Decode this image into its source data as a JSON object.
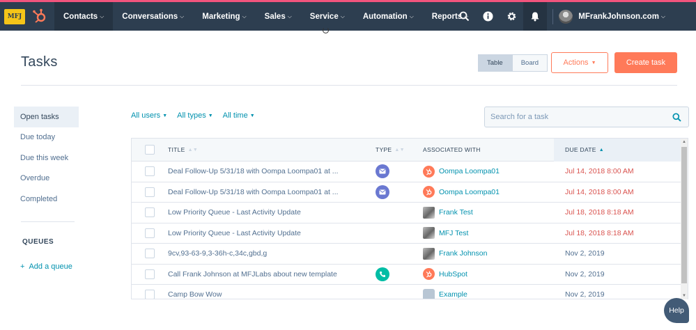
{
  "nav": {
    "logo_text": "MFJ",
    "items": [
      {
        "label": "Contacts",
        "active": true
      },
      {
        "label": "Conversations"
      },
      {
        "label": "Marketing"
      },
      {
        "label": "Sales"
      },
      {
        "label": "Service"
      },
      {
        "label": "Automation"
      },
      {
        "label": "Reports"
      }
    ],
    "account": "MFrankJohnson.com",
    "icons": [
      "search-icon",
      "info-icon",
      "gear-icon",
      "bell-icon"
    ]
  },
  "header": {
    "title": "Tasks",
    "view_table": "Table",
    "view_board": "Board",
    "actions_label": "Actions",
    "create_label": "Create task"
  },
  "sidebar": {
    "items": [
      "Open tasks",
      "Due today",
      "Due this week",
      "Overdue",
      "Completed"
    ],
    "queues_heading": "QUEUES",
    "add_queue": "Add a queue"
  },
  "filters": {
    "users": "All users",
    "types": "All types",
    "time": "All time",
    "search_placeholder": "Search for a task"
  },
  "table": {
    "columns": {
      "title": "TITLE",
      "type": "TYPE",
      "associated": "ASSOCIATED WITH",
      "due": "DUE DATE"
    },
    "rows": [
      {
        "title": "Deal Follow-Up 5/31/18 with Oompa Loompa01 at ...",
        "type": "email-icon",
        "assoc": "Oompa Loompa01",
        "assoc_icon": "hubspot-icon",
        "due": "Jul 14, 2018 8:00 AM",
        "overdue": true
      },
      {
        "title": "Deal Follow-Up 5/31/18 with Oompa Loompa01 at ...",
        "type": "email-icon",
        "assoc": "Oompa Loompa01",
        "assoc_icon": "hubspot-icon",
        "due": "Jul 14, 2018 8:00 AM",
        "overdue": true
      },
      {
        "title": "Low Priority Queue - Last Activity Update",
        "type": "",
        "assoc": "Frank Test",
        "assoc_icon": "contact-photo-icon",
        "due": "Jul 18, 2018 8:18 AM",
        "overdue": true
      },
      {
        "title": "Low Priority Queue - Last Activity Update",
        "type": "",
        "assoc": "MFJ Test",
        "assoc_icon": "contact-photo-icon",
        "due": "Jul 18, 2018 8:18 AM",
        "overdue": true
      },
      {
        "title": "9cv,93-63-9,3-36h-c,34c,gbd,g",
        "type": "",
        "assoc": "Frank Johnson",
        "assoc_icon": "contact-photo-icon",
        "due": "Nov 2, 2019",
        "overdue": false
      },
      {
        "title": "Call Frank Johnson at MFJLabs about new template",
        "type": "call-icon",
        "assoc": "HubSpot",
        "assoc_icon": "hubspot-icon",
        "due": "Nov 2, 2019",
        "overdue": false
      },
      {
        "title": "Camp Bow Wow",
        "type": "",
        "assoc": "Example",
        "assoc_icon": "company-icon",
        "due": "Nov 2, 2019",
        "overdue": false
      }
    ]
  },
  "help_label": "Help",
  "colors": {
    "nav_bg": "#2d3e50",
    "accent": "#ff7a59",
    "link": "#0091ae",
    "overdue": "#d9534f",
    "email_badge": "#6a78d1",
    "call_badge": "#00bda5"
  }
}
